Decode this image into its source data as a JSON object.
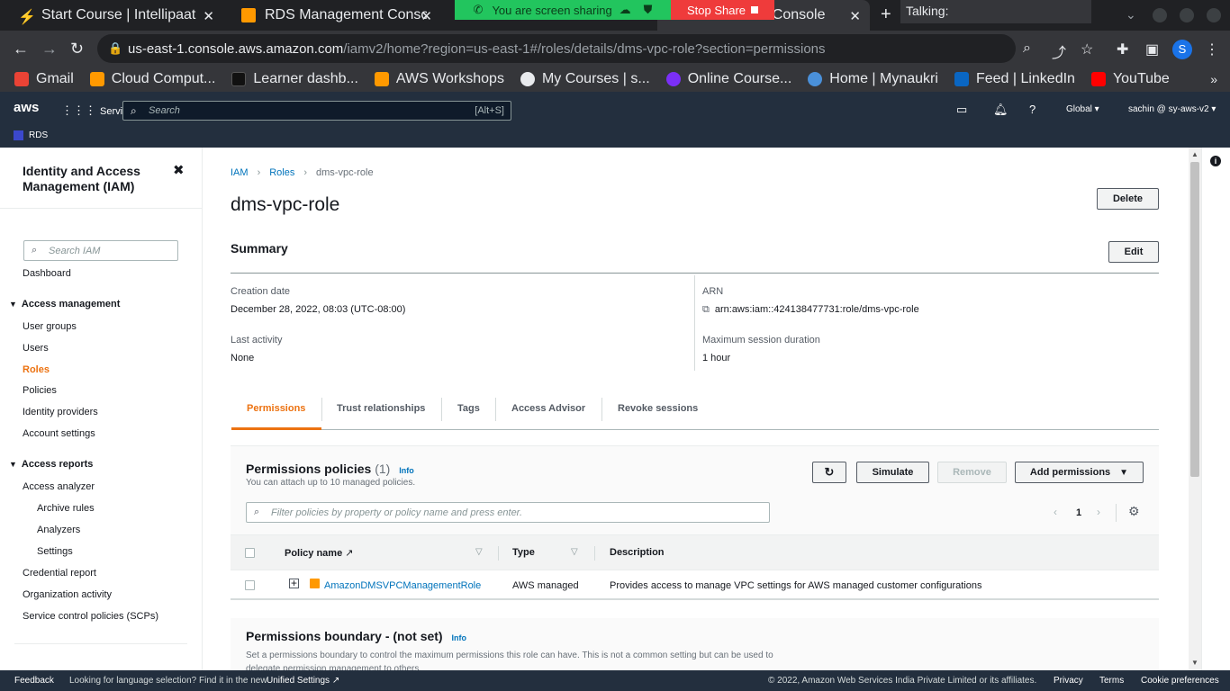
{
  "browser": {
    "tabs": [
      {
        "title": "Start Course | Intellipaat"
      },
      {
        "title": "RDS Management Console"
      },
      {
        "title": ""
      },
      {
        "title": "nt Console"
      }
    ],
    "screen_share": {
      "status": "You are screen sharing",
      "stop_label": "Stop Share"
    },
    "talking_label": "Talking:",
    "url_host": "us-east-1.console.aws.amazon.com",
    "url_path": "/iamv2/home?region=us-east-1#/roles/details/dms-vpc-role?section=permissions",
    "profile_initial": "S",
    "bookmarks": [
      {
        "label": "Gmail",
        "color": "#ea4335"
      },
      {
        "label": "Cloud Comput...",
        "color": "#ff9900"
      },
      {
        "label": "Learner dashb...",
        "color": "#111111"
      },
      {
        "label": "AWS Workshops",
        "color": "#ff9900"
      },
      {
        "label": "My Courses | s...",
        "color": "#9aa0a6"
      },
      {
        "label": "Online Course...",
        "color": "#7b2ff7"
      },
      {
        "label": "Home | Mynaukri",
        "color": "#4a90d9"
      },
      {
        "label": "Feed | LinkedIn",
        "color": "#0a66c2"
      },
      {
        "label": "YouTube",
        "color": "#ff0000"
      }
    ]
  },
  "aws_nav": {
    "logo": "aws",
    "services_label": "Services",
    "search_placeholder": "Search",
    "search_shortcut": "[Alt+S]",
    "region": "Global",
    "account": "sachin @ sy-aws-v2",
    "favorite_service": "RDS"
  },
  "sidebar": {
    "title": "Identity and Access Management (IAM)",
    "search_placeholder": "Search IAM",
    "dashboard": "Dashboard",
    "access_management": {
      "heading": "Access management",
      "items": [
        "User groups",
        "Users",
        "Roles",
        "Policies",
        "Identity providers",
        "Account settings"
      ]
    },
    "access_reports": {
      "heading": "Access reports",
      "analyzer": "Access analyzer",
      "analyzer_sub": [
        "Archive rules",
        "Analyzers",
        "Settings"
      ],
      "items": [
        "Credential report",
        "Organization activity",
        "Service control policies (SCPs)"
      ]
    }
  },
  "breadcrumb": {
    "root": "IAM",
    "section": "Roles",
    "current": "dms-vpc-role"
  },
  "role": {
    "name": "dms-vpc-role",
    "delete_label": "Delete",
    "summary_heading": "Summary",
    "edit_label": "Edit",
    "creation_date_label": "Creation date",
    "creation_date": "December 28, 2022, 08:03 (UTC-08:00)",
    "arn_label": "ARN",
    "arn": "arn:aws:iam::424138477731:role/dms-vpc-role",
    "last_activity_label": "Last activity",
    "last_activity": "None",
    "max_session_label": "Maximum session duration",
    "max_session": "1 hour"
  },
  "tabs": [
    "Permissions",
    "Trust relationships",
    "Tags",
    "Access Advisor",
    "Revoke sessions"
  ],
  "permissions": {
    "heading": "Permissions policies",
    "count": "(1)",
    "info": "Info",
    "description": "You can attach up to 10 managed policies.",
    "simulate_label": "Simulate",
    "remove_label": "Remove",
    "add_label": "Add permissions",
    "filter_placeholder": "Filter policies by property or policy name and press enter.",
    "page": "1",
    "columns": {
      "name": "Policy name",
      "type": "Type",
      "description": "Description"
    },
    "rows": [
      {
        "name": "AmazonDMSVPCManagementRole",
        "type": "AWS managed",
        "description": "Provides access to manage VPC settings for AWS managed customer configurations"
      }
    ]
  },
  "boundary": {
    "heading": "Permissions boundary - (not set)",
    "info": "Info",
    "description": "Set a permissions boundary to control the maximum permissions this role can have. This is not a common setting but can be used to delegate permission management to others."
  },
  "footer": {
    "feedback": "Feedback",
    "language_text": "Looking for language selection? Find it in the new",
    "unified_settings": "Unified Settings",
    "copyright": "© 2022, Amazon Web Services India Private Limited or its affiliates.",
    "privacy": "Privacy",
    "terms": "Terms",
    "cookies": "Cookie preferences"
  }
}
